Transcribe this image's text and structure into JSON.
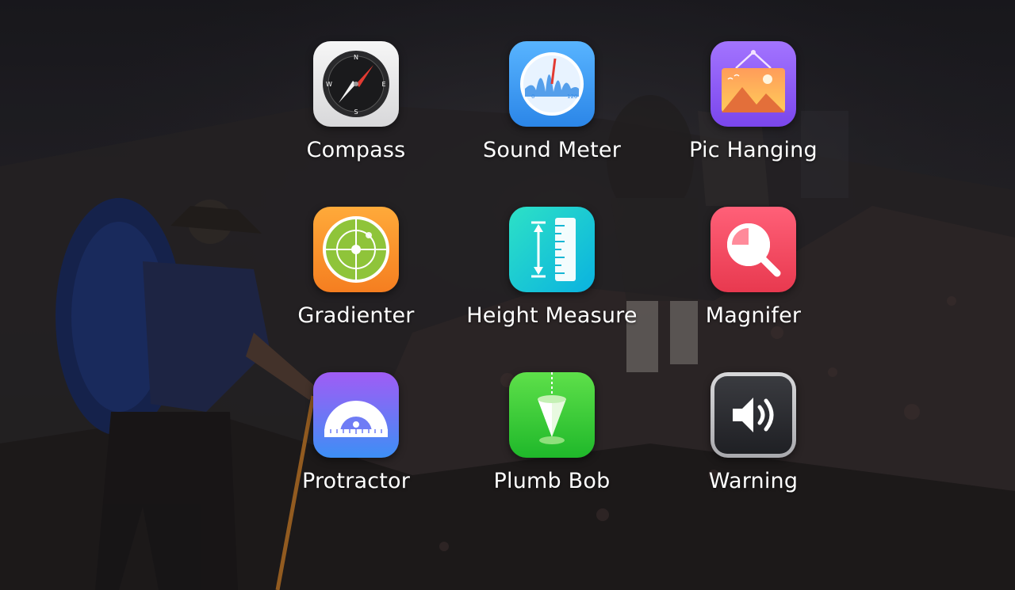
{
  "background": {
    "theme": "mountain-hikers-photo-dark"
  },
  "apps": [
    {
      "label": "Compass",
      "icon": "compass-icon",
      "color": "#e9e9ea"
    },
    {
      "label": "Sound Meter",
      "icon": "sound-meter-icon",
      "color": "#3b9bf0"
    },
    {
      "label": "Pic Hanging",
      "icon": "picture-frame-icon",
      "color": "#8a5cf6"
    },
    {
      "label": "Gradienter",
      "icon": "level-icon",
      "color": "#f7952a"
    },
    {
      "label": "Height Measure",
      "icon": "ruler-height-icon",
      "color": "#12c7d4"
    },
    {
      "label": "Magnifer",
      "icon": "magnifier-icon",
      "color": "#f04a66"
    },
    {
      "label": "Protractor",
      "icon": "protractor-icon",
      "color": "#6f7cf5"
    },
    {
      "label": "Plumb Bob",
      "icon": "plumb-bob-icon",
      "color": "#37cf3b"
    },
    {
      "label": "Warning",
      "icon": "speaker-warning-icon",
      "color": "#2c2d31"
    }
  ]
}
